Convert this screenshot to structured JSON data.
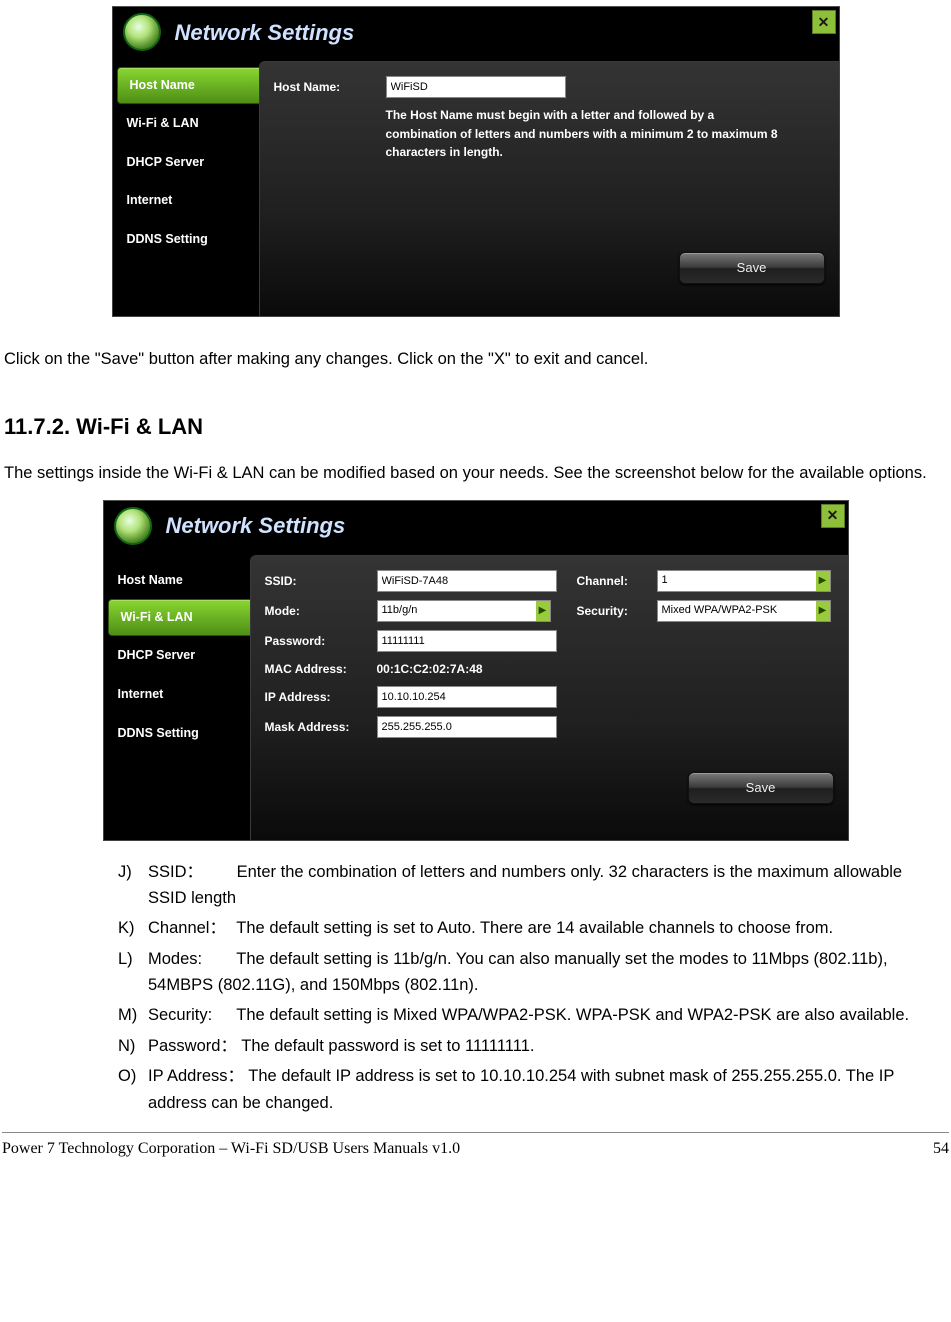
{
  "shot1": {
    "title": "Network Settings",
    "close": "✕",
    "side": [
      "Host Name",
      "Wi-Fi & LAN",
      "DHCP Server",
      "Internet",
      "DDNS Setting"
    ],
    "active": 0,
    "hostname_label": "Host Name:",
    "hostname_value": "WiFiSD",
    "note": "The Host Name must begin with a letter and followed by a combination of letters and numbers with a minimum 2 to maximum 8 characters in length.",
    "save": "Save"
  },
  "body": {
    "p1": "Click on the \"Save\" button after making any changes.   Click on the \"X\" to exit and cancel.",
    "h2": "11.7.2. Wi-Fi & LAN",
    "p2": "The settings inside the Wi-Fi & LAN can be modified based on your needs.   See the screenshot below for the available options."
  },
  "shot2": {
    "title": "Network Settings",
    "close": "✕",
    "side": [
      "Host Name",
      "Wi-Fi & LAN",
      "DHCP Server",
      "Internet",
      "DDNS Setting"
    ],
    "active": 1,
    "labels": {
      "ssid": "SSID:",
      "channel": "Channel:",
      "mode": "Mode:",
      "security": "Security:",
      "password": "Password:",
      "mac": "MAC Address:",
      "ip": "IP Address:",
      "mask": "Mask Address:"
    },
    "values": {
      "ssid": "WiFiSD-7A48",
      "channel": "1",
      "mode": "11b/g/n",
      "security": "Mixed WPA/WPA2-PSK",
      "password": "11111111",
      "mac": "00:1C:C2:02:7A:48",
      "ip": "10.10.10.254",
      "mask": "255.255.255.0"
    },
    "save": "Save"
  },
  "list": {
    "j_m": "J)",
    "j_l": "SSID：",
    "j_t": "Enter the combination of letters and numbers only.   32 characters is the maximum allowable SSID length",
    "k_m": "K)",
    "k_l": "Channel：",
    "k_t": "The default setting is set to Auto.   There are 14 available channels to choose from.",
    "l_m": "L)",
    "l_l": "Modes:",
    "l_t": "The default setting is 11b/g/n.   You can also manually set the modes to 11Mbps (802.11b), 54MBPS (802.11G), and 150Mbps (802.11n).",
    "m_m": "M)",
    "m_l": "Security:",
    "m_t": "The default setting is Mixed WPA/WPA2-PSK. WPA-PSK and WPA2-PSK are also available.",
    "n_m": "N)",
    "n_l": "Password：",
    "n_t": "The default password is set to 11111111.",
    "o_m": "O)",
    "o_l": "IP Address：",
    "o_t": "The default IP address is set to 10.10.10.254 with subnet mask of 255.255.255.0.   The IP address can be changed."
  },
  "footer": {
    "left": "Power 7 Technology Corporation – Wi-Fi SD/USB Users Manuals v1.0",
    "right": "54"
  }
}
